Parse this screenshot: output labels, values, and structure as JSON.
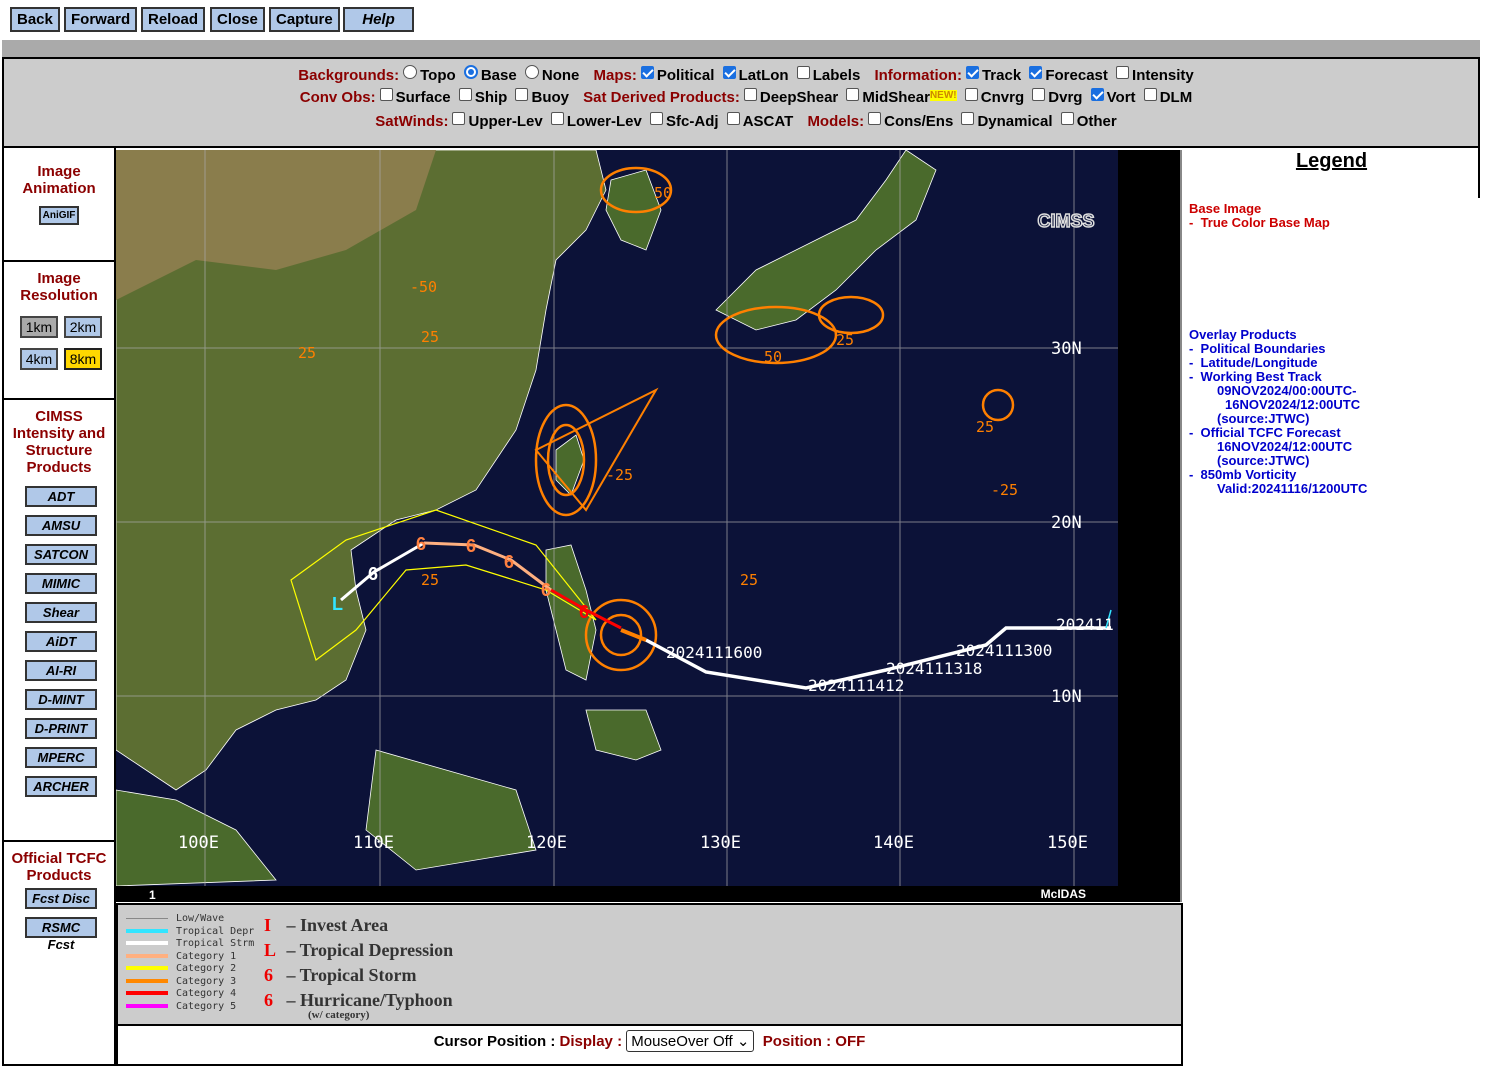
{
  "toolbar": {
    "back": "Back",
    "forward": "Forward",
    "reload": "Reload",
    "close": "Close",
    "capture": "Capture",
    "help": "Help"
  },
  "options": {
    "backgrounds": {
      "label": "Backgrounds:",
      "items": [
        {
          "label": "Topo",
          "selected": false
        },
        {
          "label": "Base",
          "selected": true
        },
        {
          "label": "None",
          "selected": false
        }
      ]
    },
    "maps": {
      "label": "Maps:",
      "items": [
        {
          "label": "Political",
          "checked": true
        },
        {
          "label": "LatLon",
          "checked": true
        },
        {
          "label": "Labels",
          "checked": false
        }
      ]
    },
    "information": {
      "label": "Information:",
      "items": [
        {
          "label": "Track",
          "checked": true
        },
        {
          "label": "Forecast",
          "checked": true
        },
        {
          "label": "Intensity",
          "checked": false
        }
      ]
    },
    "conv_obs": {
      "label": "Conv Obs:",
      "items": [
        {
          "label": "Surface",
          "checked": false
        },
        {
          "label": "Ship",
          "checked": false
        },
        {
          "label": "Buoy",
          "checked": false
        }
      ]
    },
    "sat_derived": {
      "label": "Sat Derived Products:",
      "items": [
        {
          "label": "DeepShear",
          "checked": false
        },
        {
          "label": "MidShear",
          "checked": false,
          "badge": "NEW!"
        },
        {
          "label": "Cnvrg",
          "checked": false
        },
        {
          "label": "Dvrg",
          "checked": false
        },
        {
          "label": "Vort",
          "checked": true
        },
        {
          "label": "DLM",
          "checked": false
        }
      ]
    },
    "satwinds": {
      "label": "SatWinds:",
      "items": [
        {
          "label": "Upper-Lev",
          "checked": false
        },
        {
          "label": "Lower-Lev",
          "checked": false
        },
        {
          "label": "Sfc-Adj",
          "checked": false
        },
        {
          "label": "ASCAT",
          "checked": false
        }
      ]
    },
    "models": {
      "label": "Models:",
      "items": [
        {
          "label": "Cons/Ens",
          "checked": false
        },
        {
          "label": "Dynamical",
          "checked": false
        },
        {
          "label": "Other",
          "checked": false
        }
      ]
    }
  },
  "sidebar": {
    "animation": {
      "title": "Image Animation",
      "button": "AniGIF"
    },
    "resolution": {
      "title": "Image Resolution",
      "options": [
        {
          "label": "1km",
          "state": "disabled"
        },
        {
          "label": "2km",
          "state": "normal"
        },
        {
          "label": "4km",
          "state": "normal"
        },
        {
          "label": "8km",
          "state": "selected"
        }
      ]
    },
    "cimss": {
      "title": "CIMSS Intensity and Structure Products",
      "buttons": [
        "ADT",
        "AMSU",
        "SATCON",
        "MIMIC",
        "Shear",
        "AiDT",
        "AI-RI",
        "D-MINT",
        "D-PRINT",
        "MPERC",
        "ARCHER"
      ]
    },
    "tcfc": {
      "title": "Official TCFC Products",
      "buttons": [
        "Fcst Disc",
        "RSMC Fcst"
      ]
    }
  },
  "map": {
    "lon_labels": [
      "100E",
      "110E",
      "120E",
      "130E",
      "140E",
      "150E"
    ],
    "lat_labels": [
      "30N",
      "20N",
      "10N"
    ],
    "track_labels": [
      "2024111600",
      "2024111412",
      "2024111318",
      "2024111300",
      "202411"
    ],
    "vort_labels": [
      "25",
      "50",
      "-25",
      "-50"
    ],
    "frame": "1",
    "logo": "McIDAS",
    "watermark": "CIMSS"
  },
  "legend": {
    "title": "Legend",
    "base_heading": "Base Image",
    "base_items": [
      "True Color Base Map"
    ],
    "overlay_heading": "Overlay Products",
    "overlay_items": [
      {
        "label": "Political Boundaries",
        "details": []
      },
      {
        "label": "Latitude/Longitude",
        "details": []
      },
      {
        "label": "Working Best Track",
        "details": [
          "09NOV2024/00:00UTC-",
          "16NOV2024/12:00UTC",
          "(source:JTWC)"
        ]
      },
      {
        "label": "Official TCFC Forecast",
        "details": [
          "16NOV2024/12:00UTC",
          "(source:JTWC)"
        ]
      },
      {
        "label": "850mb Vorticity",
        "details": [
          "Valid:20241116/1200UTC"
        ]
      }
    ],
    "colors": {
      "base": "#cc0000",
      "overlay": "#0000cc"
    }
  },
  "track_legend": {
    "lines": [
      {
        "label": "Low/Wave",
        "color": "#888888"
      },
      {
        "label": "Tropical Depr",
        "color": "#33e5ff"
      },
      {
        "label": "Tropical Strm",
        "color": "#ffffff"
      },
      {
        "label": "Category 1",
        "color": "#ffb080"
      },
      {
        "label": "Category 2",
        "color": "#ffff00"
      },
      {
        "label": "Category 3",
        "color": "#ff8800"
      },
      {
        "label": "Category 4",
        "color": "#ff0000"
      },
      {
        "label": "Category 5",
        "color": "#ff00ff"
      }
    ],
    "symbols": [
      {
        "glyph": "I",
        "label": "– Invest Area"
      },
      {
        "glyph": "L",
        "label": "– Tropical Depression"
      },
      {
        "glyph": "6",
        "label": "– Tropical Storm"
      },
      {
        "glyph": "6",
        "label": "– Hurricane/Typhoon"
      }
    ],
    "note": "(w/ category)"
  },
  "cursor": {
    "label": "Cursor Position :",
    "display_label": "Display :",
    "select_value": "MouseOver Off",
    "position_label": "Position :",
    "position_value": "OFF"
  }
}
